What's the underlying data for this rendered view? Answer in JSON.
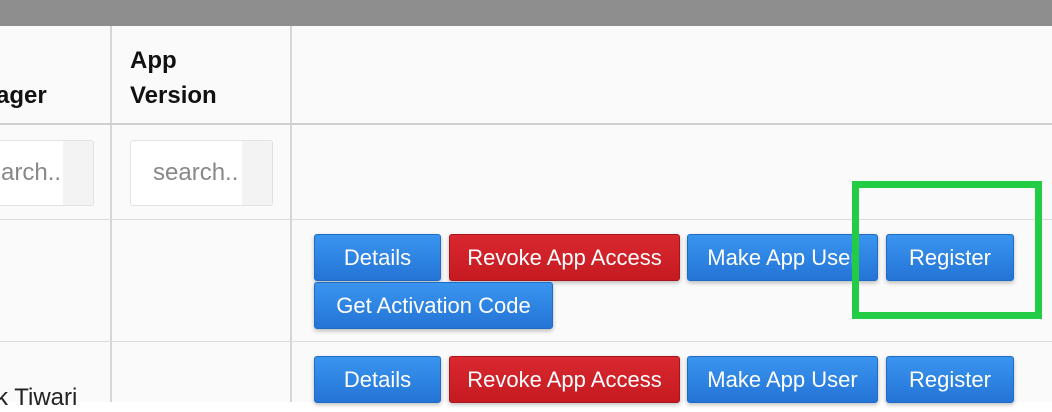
{
  "table": {
    "headers": {
      "manager": "ager",
      "app_version": "App\nVersion",
      "app_version_line1": "App",
      "app_version_line2": "Version"
    },
    "filters": {
      "manager_placeholder": "arch..",
      "app_version_placeholder": "search.."
    },
    "rows": [
      {
        "manager": "",
        "actions": {
          "details": "Details",
          "revoke": "Revoke App Access",
          "make_user": "Make App User",
          "register": "Register",
          "activation": "Get Activation Code"
        }
      },
      {
        "manager": "k Tiwari",
        "actions": {
          "details": "Details",
          "revoke": "Revoke App Access",
          "make_user": "Make App User",
          "register": "Register"
        }
      }
    ]
  },
  "colors": {
    "primary_button": "#2b80e0",
    "danger_button": "#cc2128",
    "highlight": "#22cc44",
    "top_bar": "#8e8e8e"
  }
}
